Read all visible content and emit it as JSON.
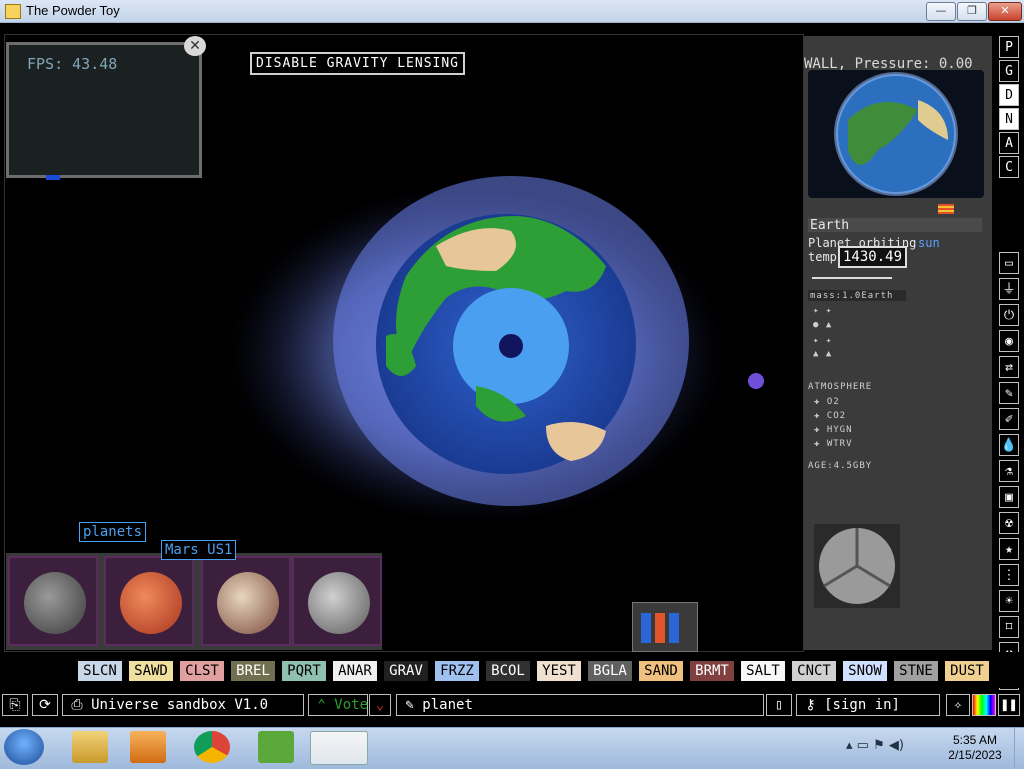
{
  "window": {
    "title": "The Powder Toy",
    "minimize": "—",
    "maximize": "❐",
    "close": "✕"
  },
  "hud": {
    "fps": "FPS: 43.48",
    "tooltip": "DISABLE GRAVITY LENSING",
    "cursor_info": "WALL, Pressure: 0.00"
  },
  "info_panel": {
    "name": "Earth",
    "desc": "Planet orbiting",
    "desc_link": "sun",
    "temp_label": "temp",
    "temp_value": "1430.49",
    "mass": "mass:1.0Earth",
    "atmosphere": "ATMOSPHERE",
    "gases": [
      "O2",
      "CO2",
      "HYGN",
      "WTRV"
    ],
    "age": "AGE:4.5GBY"
  },
  "search": {
    "category": "planets",
    "hover_label": "Mars US1"
  },
  "sidebar_top": [
    "P",
    "G",
    "D",
    "N",
    "A",
    "C"
  ],
  "sidebar_icons": [
    "monitor-icon",
    "power-plug-icon",
    "power-icon",
    "sensor-icon",
    "arrows-icon",
    "paint-icon",
    "brush-icon",
    "drop-icon",
    "flask-icon",
    "box-icon",
    "radiation-icon",
    "star-icon",
    "dots-icon",
    "bulb-icon",
    "bookmark-icon",
    "hammer-icon",
    "magnify-icon"
  ],
  "elements": [
    {
      "label": "SLCN",
      "bg": "#c8d8e8"
    },
    {
      "label": "SAWD",
      "bg": "#f0e0a0"
    },
    {
      "label": "CLST",
      "bg": "#e0a0a0"
    },
    {
      "label": "BREL",
      "bg": "#707050"
    },
    {
      "label": "PQRT",
      "bg": "#90c0b0"
    },
    {
      "label": "ANAR",
      "bg": "#f0f0f0"
    },
    {
      "label": "GRAV",
      "bg": "#202020"
    },
    {
      "label": "FRZZ",
      "bg": "#a0c0f0"
    },
    {
      "label": "BCOL",
      "bg": "#303030"
    },
    {
      "label": "YEST",
      "bg": "#f0e0d0"
    },
    {
      "label": "BGLA",
      "bg": "#606060"
    },
    {
      "label": "SAND",
      "bg": "#f0c080"
    },
    {
      "label": "BRMT",
      "bg": "#804040"
    },
    {
      "label": "SALT",
      "bg": "#f8f8f8"
    },
    {
      "label": "CNCT",
      "bg": "#d0d0d0"
    },
    {
      "label": "SNOW",
      "bg": "#d0e0ff"
    },
    {
      "label": "STNE",
      "bg": "#a0a0a0"
    },
    {
      "label": "DUST",
      "bg": "#f0d090"
    }
  ],
  "controls": {
    "save_name": "Universe sandbox V1.0",
    "vote": "Vote",
    "tag": "planet",
    "sign_in": "[sign in]"
  },
  "taskbar": {
    "time": "5:35 AM",
    "date": "2/15/2023"
  }
}
